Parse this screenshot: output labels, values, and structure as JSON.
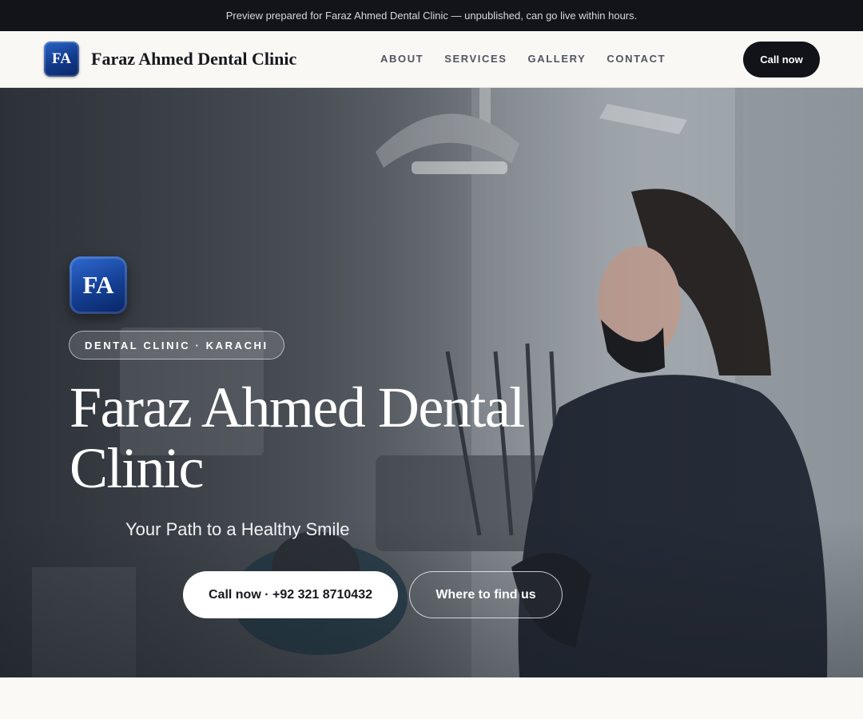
{
  "preview_bar": {
    "text": "Preview prepared for Faraz Ahmed Dental Clinic — unpublished, can go live within hours."
  },
  "header": {
    "logo_initials": "FA",
    "brand_name": "Faraz Ahmed Dental Clinic",
    "nav": [
      {
        "label": "ABOUT"
      },
      {
        "label": "SERVICES"
      },
      {
        "label": "GALLERY"
      },
      {
        "label": "CONTACT"
      }
    ],
    "cta_label": "Call now"
  },
  "hero": {
    "logo_initials": "FA",
    "tag": "DENTAL CLINIC · KARACHI",
    "title": "Faraz Ahmed Dental Clinic",
    "subtitle": "Your Path to a Healthy Smile",
    "primary_cta": "Call now · +92 321 8710432",
    "secondary_cta": "Where to find us",
    "background_image": "dentist-with-patient-photo"
  },
  "colors": {
    "preview_bar_bg": "#121419",
    "header_bg": "#f9f8f5",
    "cta_dark": "#111318",
    "logo_blue": "#143f93",
    "page_bg": "#f8f7f4"
  }
}
